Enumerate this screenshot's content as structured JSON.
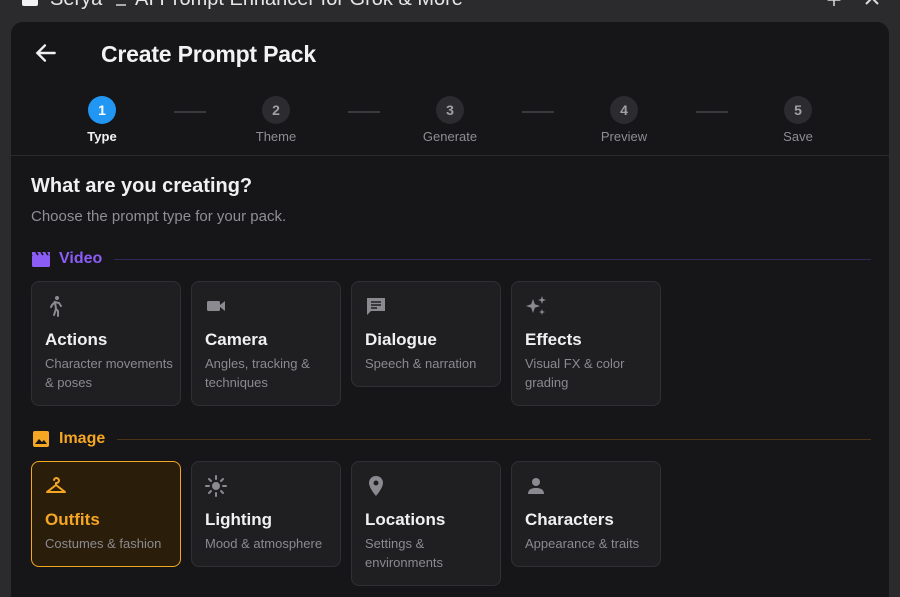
{
  "window": {
    "app_name": "Serya",
    "title": "AI Prompt Enhancer for Grok & More"
  },
  "header": {
    "title": "Create Prompt Pack"
  },
  "steps": [
    {
      "number": "1",
      "label": "Type",
      "active": true
    },
    {
      "number": "2",
      "label": "Theme",
      "active": false
    },
    {
      "number": "3",
      "label": "Generate",
      "active": false
    },
    {
      "number": "4",
      "label": "Preview",
      "active": false
    },
    {
      "number": "5",
      "label": "Save",
      "active": false
    }
  ],
  "content": {
    "heading": "What are you creating?",
    "subheading": "Choose the prompt type for your pack."
  },
  "sections": {
    "video": {
      "name": "Video",
      "icon": "clapperboard-icon",
      "color": "#8b5cf6",
      "cards": [
        {
          "name": "Actions",
          "desc": "Character movements & poses",
          "icon": "running-person-icon"
        },
        {
          "name": "Camera",
          "desc": "Angles, tracking & techniques",
          "icon": "video-camera-icon"
        },
        {
          "name": "Dialogue",
          "desc": "Speech & narration",
          "icon": "chat-bubble-icon"
        },
        {
          "name": "Effects",
          "desc": "Visual FX & color grading",
          "icon": "sparkles-icon"
        }
      ]
    },
    "image": {
      "name": "Image",
      "icon": "image-icon",
      "color": "#f5a623",
      "cards": [
        {
          "name": "Outfits",
          "desc": "Costumes & fashion",
          "icon": "hanger-icon",
          "selected": true
        },
        {
          "name": "Lighting",
          "desc": "Mood & atmosphere",
          "icon": "sun-icon"
        },
        {
          "name": "Locations",
          "desc": "Settings & environments",
          "icon": "location-pin-icon"
        },
        {
          "name": "Characters",
          "desc": "Appearance & traits",
          "icon": "person-icon"
        }
      ]
    }
  },
  "colors": {
    "accent_blue": "#2196f3",
    "video_purple": "#8b5cf6",
    "image_orange": "#f5a623",
    "panel_bg": "#161618",
    "card_bg": "#1f1f22"
  }
}
